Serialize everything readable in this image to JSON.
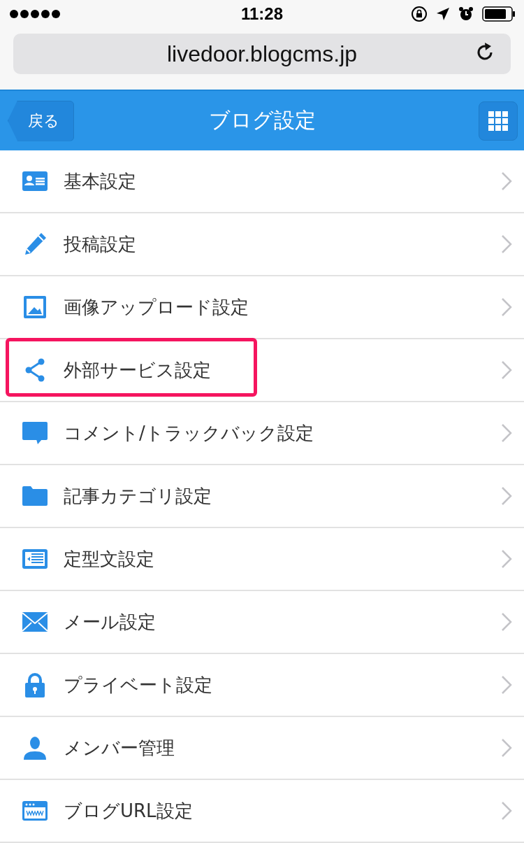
{
  "status_bar": {
    "time": "11:28"
  },
  "address_bar": {
    "url": "livedoor.blogcms.jp"
  },
  "header": {
    "back": "戻る",
    "title": "ブログ設定"
  },
  "items": [
    {
      "kind": "profile",
      "label": "基本設定",
      "highlighted": false
    },
    {
      "kind": "pencil",
      "label": "投稿設定",
      "highlighted": false
    },
    {
      "kind": "image",
      "label": "画像アップロード設定",
      "highlighted": false
    },
    {
      "kind": "share",
      "label": "外部サービス設定",
      "highlighted": true
    },
    {
      "kind": "comment",
      "label": "コメント/トラックバック設定",
      "highlighted": false
    },
    {
      "kind": "folder",
      "label": "記事カテゴリ設定",
      "highlighted": false
    },
    {
      "kind": "template",
      "label": "定型文設定",
      "highlighted": false
    },
    {
      "kind": "mail",
      "label": "メール設定",
      "highlighted": false
    },
    {
      "kind": "lock",
      "label": "プライベート設定",
      "highlighted": false
    },
    {
      "kind": "person",
      "label": "メンバー管理",
      "highlighted": false
    },
    {
      "kind": "browser",
      "label": "ブログURL設定",
      "highlighted": false
    }
  ]
}
